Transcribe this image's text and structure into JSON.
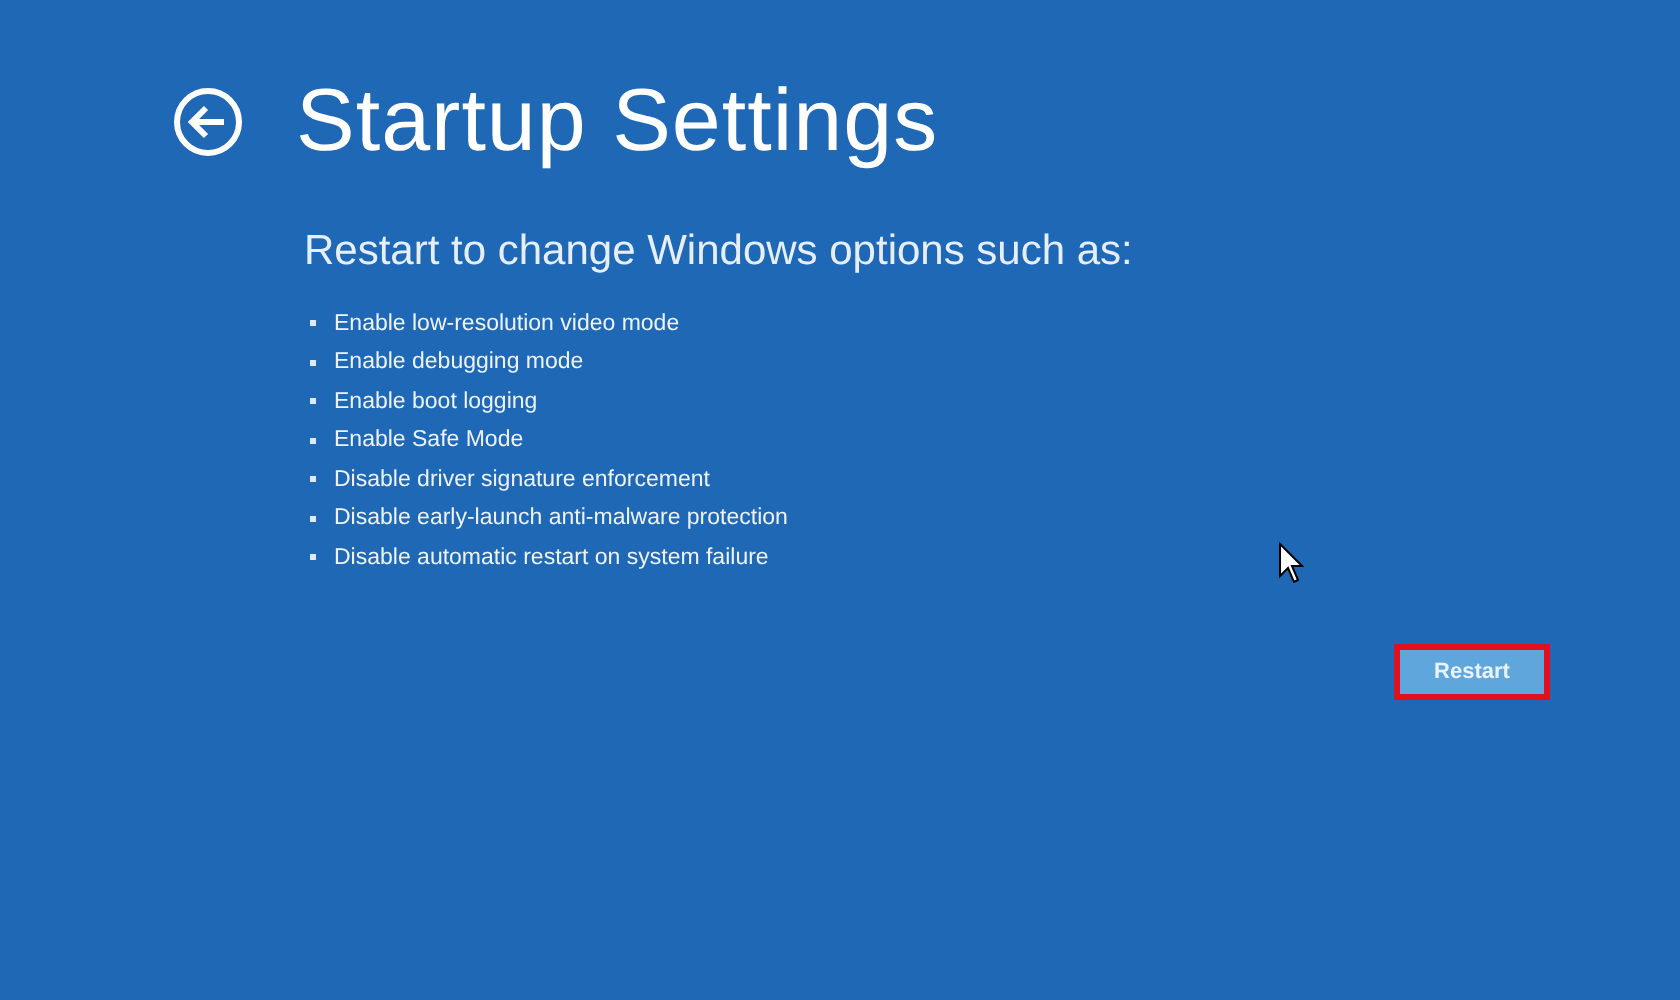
{
  "title": "Startup Settings",
  "subtitle": "Restart to change Windows options such as:",
  "options": [
    "Enable low-resolution video mode",
    "Enable debugging mode",
    "Enable boot logging",
    "Enable Safe Mode",
    "Disable driver signature enforcement",
    "Disable early-launch anti-malware protection",
    "Disable automatic restart on system failure"
  ],
  "restart_button": {
    "label": "Restart",
    "highlighted": true
  }
}
